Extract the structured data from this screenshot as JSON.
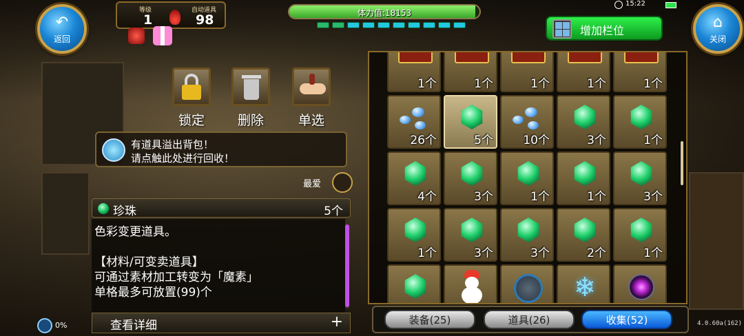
{
  "header": {
    "back_label": "返回",
    "close_label": "关闭",
    "level_label": "等级",
    "level_value": "1",
    "auto_label": "自动道具",
    "auto_value": "98",
    "stamina_text": "体力值:18153",
    "stamina_fraction": 0.98,
    "add_slot_label": "增加栏位",
    "clock": "15:22"
  },
  "actions": {
    "lock": "锁定",
    "delete": "删除",
    "single": "单选"
  },
  "notice": {
    "line1": "有道具溢出背包！",
    "line2": "请点触此处进行回收！"
  },
  "favorite_label": "最爱",
  "item": {
    "name": "珍珠",
    "count": "5个",
    "desc1": "色彩变更道具。",
    "desc2": "【材料/可变卖道具】",
    "desc3": "可通过素材加工转变为「魔素」",
    "desc4": "单格最多可放置(99)个",
    "detail_label": "查看详细",
    "plus": "+"
  },
  "progress_pct": "0%",
  "grid": [
    [
      "1个",
      "1个",
      "1个",
      "1个",
      "1个"
    ],
    [
      "26个",
      "5个",
      "10个",
      "3个",
      "1个"
    ],
    [
      "4个",
      "3个",
      "1个",
      "1个",
      "3个"
    ],
    [
      "1个",
      "3个",
      "3个",
      "2个",
      "1个"
    ]
  ],
  "tabs": {
    "equip": "装备(25)",
    "items": "道具(26)",
    "collect": "收集(52)"
  },
  "version": "4.0.60a(162)"
}
